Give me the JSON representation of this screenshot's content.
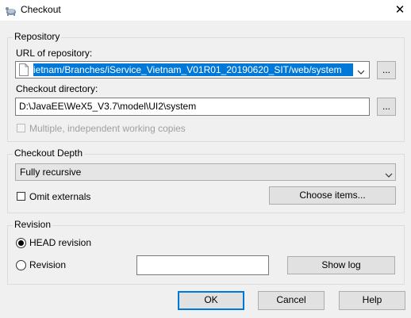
{
  "window": {
    "title": "Checkout",
    "close_glyph": "✕",
    "app_icon": "tortoise-svn-icon"
  },
  "repository": {
    "group_label": "Repository",
    "url_label": "URL of repository:",
    "url_value": "ietnam/Branches/iService_Vietnam_V01R01_20190620_SIT/web/system",
    "checkout_dir_label": "Checkout directory:",
    "checkout_dir_value": "D:\\JavaEE\\WeX5_V3.7\\model\\UI2\\system",
    "browse_label": "...",
    "multiple_copies_label": "Multiple, independent working copies",
    "multiple_copies_checked": false
  },
  "depth": {
    "group_label": "Checkout Depth",
    "selected": "Fully recursive",
    "omit_externals_label": "Omit externals",
    "omit_externals_checked": false,
    "choose_items_label": "Choose items..."
  },
  "revision": {
    "group_label": "Revision",
    "head_label": "HEAD revision",
    "head_selected": true,
    "revision_label": "Revision",
    "revision_value": "",
    "show_log_label": "Show log"
  },
  "footer": {
    "ok_label": "OK",
    "cancel_label": "Cancel",
    "help_label": "Help"
  },
  "colors": {
    "selection": "#0078d7",
    "dialog_bg": "#f0f0f0"
  }
}
